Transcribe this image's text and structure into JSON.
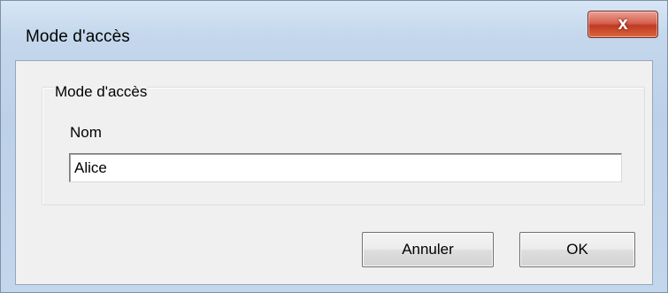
{
  "window": {
    "title": "Mode d'accès",
    "close_label": "x"
  },
  "group": {
    "legend": "Mode d'accès"
  },
  "name_field": {
    "label": "Nom",
    "value": "Alice"
  },
  "buttons": {
    "cancel_label": "Annuler",
    "ok_label": "OK"
  },
  "colors": {
    "titlebar": "#c4d7ec",
    "client_background": "#f0f0f0",
    "close_button": "#c8422b"
  }
}
